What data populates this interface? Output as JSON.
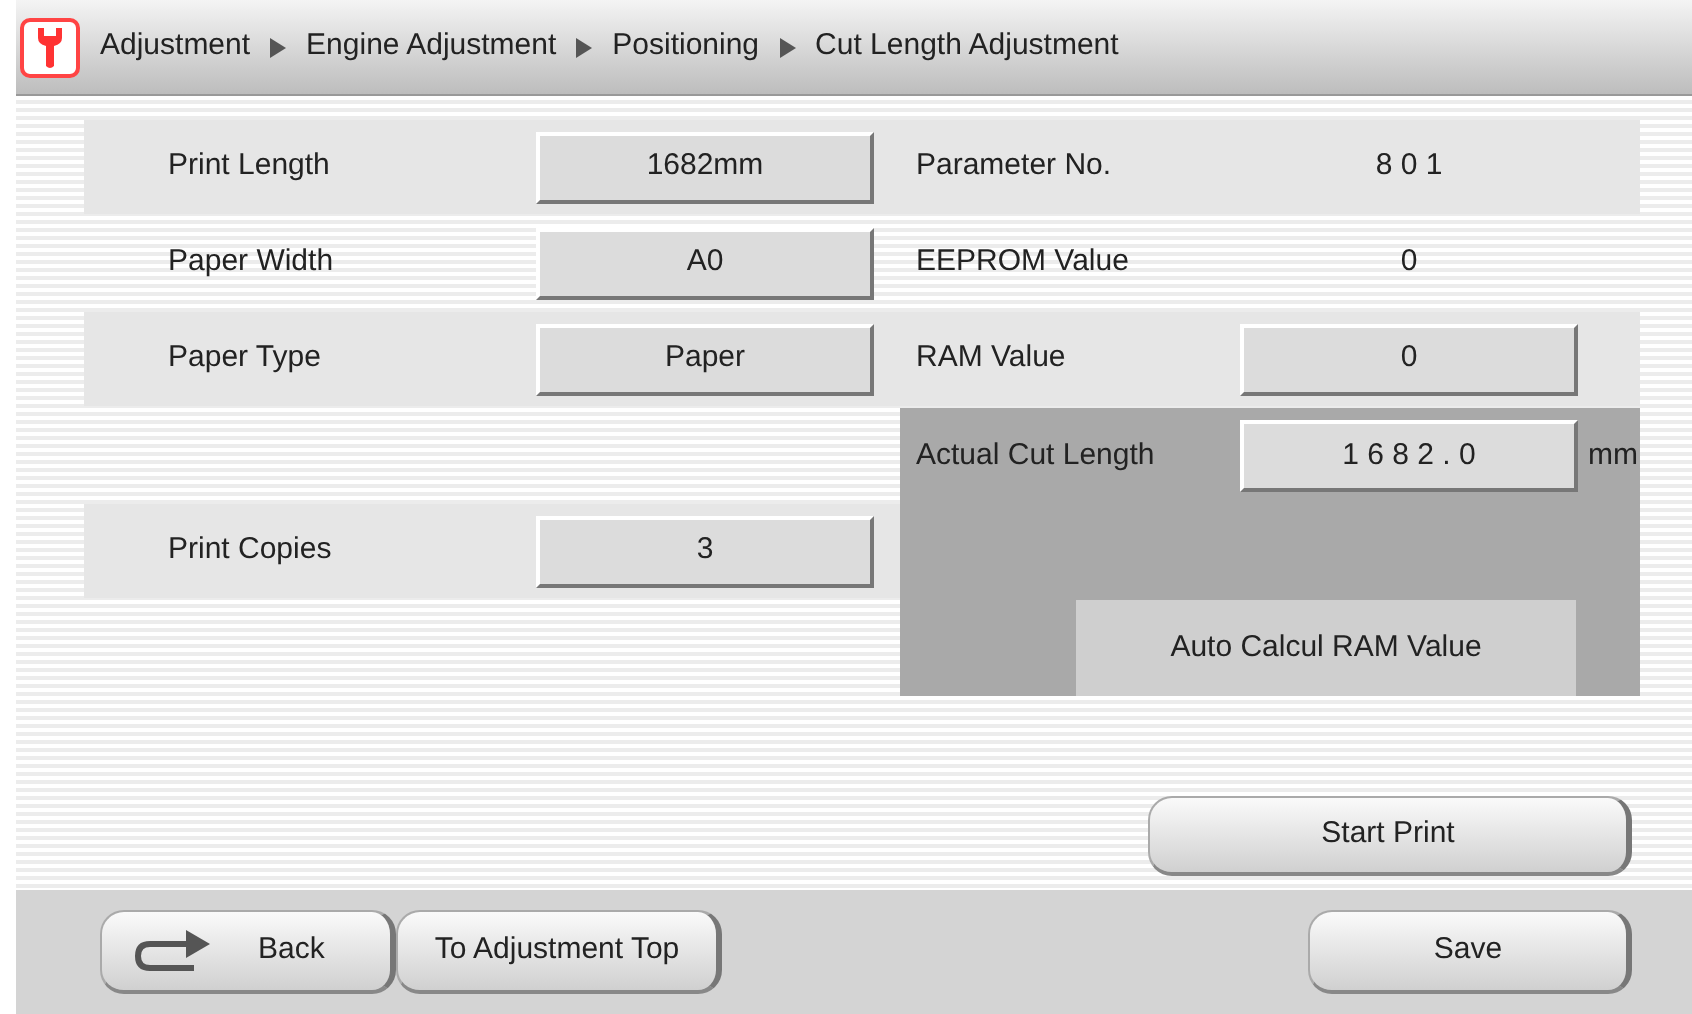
{
  "breadcrumb": [
    "Adjustment",
    "Engine Adjustment",
    "Positioning",
    "Cut Length Adjustment"
  ],
  "left_rows": [
    {
      "label": "Print Length",
      "value": "1682mm",
      "kind": "field"
    },
    {
      "label": "Paper Width",
      "value": "A0",
      "kind": "field"
    },
    {
      "label": "Paper Type",
      "value": "Paper",
      "kind": "field"
    },
    {
      "kind": "blank"
    },
    {
      "label": "Print Copies",
      "value": "3",
      "kind": "field"
    }
  ],
  "right_rows": [
    {
      "label": "Parameter No.",
      "value": "8 0 1",
      "kind": "text"
    },
    {
      "label": "EEPROM Value",
      "value": "0",
      "kind": "text"
    },
    {
      "label": "RAM Value",
      "value": "0",
      "kind": "field"
    }
  ],
  "cut_panel": {
    "label": "Actual Cut Length",
    "value": "1 6 8 2 . 0",
    "unit": "mm",
    "button": "Auto Calcul RAM Value"
  },
  "start_print": "Start Print",
  "footer": {
    "back": "Back",
    "top": "To Adjustment Top",
    "save": "Save"
  }
}
